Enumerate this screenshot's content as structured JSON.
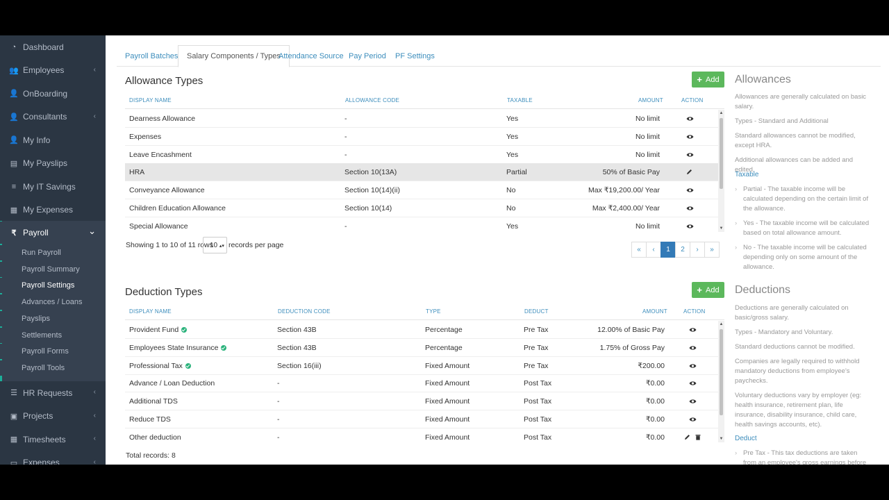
{
  "sidebar": {
    "items": [
      {
        "label": "Dashboard",
        "icon": "dashboard-icon",
        "chevron": false
      },
      {
        "label": "Employees",
        "icon": "users-icon",
        "chevron": true
      },
      {
        "label": "OnBoarding",
        "icon": "user-add-icon",
        "chevron": false
      },
      {
        "label": "Consultants",
        "icon": "user-icon",
        "chevron": true
      },
      {
        "label": "My Info",
        "icon": "user-circle-icon",
        "chevron": false
      },
      {
        "label": "My Payslips",
        "icon": "book-icon",
        "chevron": false
      },
      {
        "label": "My IT Savings",
        "icon": "database-icon",
        "chevron": false
      },
      {
        "label": "My Expenses",
        "icon": "calendar-icon",
        "chevron": false
      },
      {
        "label": "Payroll",
        "icon": "rupee-icon",
        "chevron": true
      },
      {
        "label": "HR Requests",
        "icon": "tasks-icon",
        "chevron": true
      },
      {
        "label": "Projects",
        "icon": "briefcase-icon",
        "chevron": true
      },
      {
        "label": "Timesheets",
        "icon": "calendar-icon",
        "chevron": true
      },
      {
        "label": "Expenses",
        "icon": "wallet-icon",
        "chevron": true
      }
    ],
    "payroll_sub": [
      "Run Payroll",
      "Payroll Summary",
      "Payroll Settings",
      "Advances / Loans",
      "Payslips",
      "Settlements",
      "Payroll Forms",
      "Payroll Tools"
    ]
  },
  "tabs": [
    "Payroll Batches",
    "Salary Components / Types",
    "Attendance Source",
    "Pay Period",
    "PF Settings"
  ],
  "allowance": {
    "title": "Allowance Types",
    "add_label": "Add",
    "headers": [
      "DISPLAY NAME",
      "ALLOWANCE CODE",
      "TAXABLE",
      "AMOUNT",
      "ACTION"
    ],
    "rows": [
      {
        "name": "Dearness Allowance",
        "code": "-",
        "taxable": "Yes",
        "amount": "No limit",
        "action": "eye"
      },
      {
        "name": "Expenses",
        "code": "-",
        "taxable": "Yes",
        "amount": "No limit",
        "action": "eye"
      },
      {
        "name": "Leave Encashment",
        "code": "-",
        "taxable": "Yes",
        "amount": "No limit",
        "action": "eye"
      },
      {
        "name": "HRA",
        "code": "Section 10(13A)",
        "taxable": "Partial",
        "amount": "50% of Basic Pay",
        "action": "edit"
      },
      {
        "name": "Conveyance Allowance",
        "code": "Section 10(14)(ii)",
        "taxable": "No",
        "amount": "Max ₹19,200.00/ Year",
        "action": "eye"
      },
      {
        "name": "Children Education Allowance",
        "code": "Section 10(14)",
        "taxable": "No",
        "amount": "Max ₹2,400.00/ Year",
        "action": "eye"
      },
      {
        "name": "Special Allowance",
        "code": "-",
        "taxable": "Yes",
        "amount": "No limit",
        "action": "eye"
      }
    ],
    "showing": "Showing 1 to 10 of 11 rows",
    "per_page": "10",
    "per_page_suffix": "records per page",
    "pages": [
      "«",
      "‹",
      "1",
      "2",
      "›",
      "»"
    ]
  },
  "deduction": {
    "title": "Deduction Types",
    "add_label": "Add",
    "headers": [
      "DISPLAY NAME",
      "DEDUCTION CODE",
      "TYPE",
      "DEDUCT",
      "AMOUNT",
      "ACTION"
    ],
    "rows": [
      {
        "name": "Provident Fund",
        "verified": true,
        "code": "Section 43B",
        "type": "Percentage",
        "deduct": "Pre Tax",
        "amount": "12.00% of Basic Pay",
        "action": "eye"
      },
      {
        "name": "Employees State Insurance",
        "verified": true,
        "code": "Section 43B",
        "type": "Percentage",
        "deduct": "Pre Tax",
        "amount": "1.75% of Gross Pay",
        "action": "eye"
      },
      {
        "name": "Professional Tax",
        "verified": true,
        "code": "Section 16(iii)",
        "type": "Fixed Amount",
        "deduct": "Pre Tax",
        "amount": "₹200.00",
        "action": "eye"
      },
      {
        "name": "Advance / Loan Deduction",
        "verified": false,
        "code": "-",
        "type": "Fixed Amount",
        "deduct": "Post Tax",
        "amount": "₹0.00",
        "action": "eye"
      },
      {
        "name": "Additional TDS",
        "verified": false,
        "code": "-",
        "type": "Fixed Amount",
        "deduct": "Post Tax",
        "amount": "₹0.00",
        "action": "eye"
      },
      {
        "name": "Reduce TDS",
        "verified": false,
        "code": "-",
        "type": "Fixed Amount",
        "deduct": "Post Tax",
        "amount": "₹0.00",
        "action": "eye"
      },
      {
        "name": "Other deduction",
        "verified": false,
        "code": "-",
        "type": "Fixed Amount",
        "deduct": "Post Tax",
        "amount": "₹0.00",
        "action": "edit-delete"
      }
    ],
    "total": "Total records: 8"
  },
  "info_allowances": {
    "title": "Allowances",
    "p1": "Allowances are generally calculated on basic salary.",
    "p2": "Types - Standard and Additional",
    "p3": "Standard allowances cannot be modified, except HRA.",
    "p4": "Additional allowances can be added and edited.",
    "taxable_link": "Taxable",
    "b1": "Partial - The taxable income will be calculated depending on the certain limit of the allowance.",
    "b2": "Yes - The taxable income will be calculated based on total allowance amount.",
    "b3": "No - The taxable income will be calculated depending only on some amount of the allowance."
  },
  "info_deductions": {
    "title": "Deductions",
    "p1": "Deductions are generally calculated on basic/gross salary.",
    "p2": "Types - Mandatory and Voluntary.",
    "p3": "Standard deductions cannot be modified.",
    "p4": "Companies are legally required to withhold mandatory deductions from employee's paychecks.",
    "p5": "Voluntary deductions vary by employer (eg: health insurance, retirement plan, life insurance, disability insurance, child care, health savings accounts, etc).",
    "deduct_link": "Deduct",
    "b1": "Pre Tax - This tax deductions are taken from an employee's gross earnings before tax"
  }
}
